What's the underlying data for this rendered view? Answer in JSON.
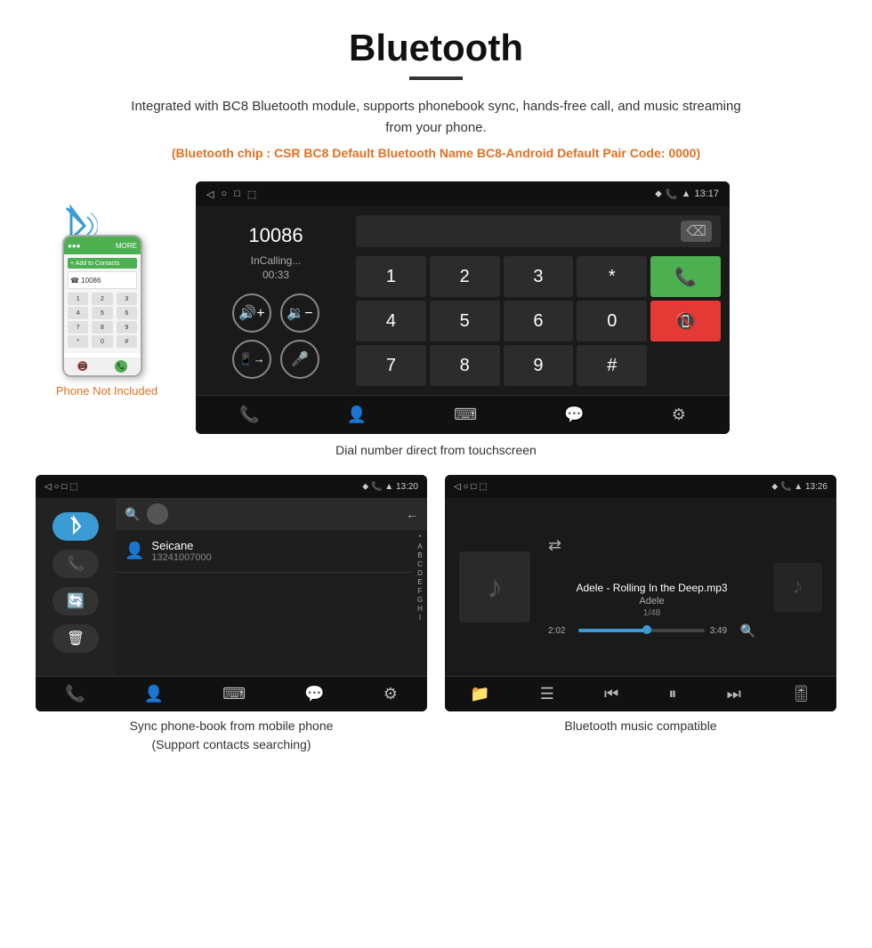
{
  "header": {
    "title": "Bluetooth",
    "intro": "Integrated with BC8 Bluetooth module, supports phonebook sync, hands-free call, and music streaming from your phone.",
    "spec": "(Bluetooth chip : CSR BC8    Default Bluetooth Name BC8-Android    Default Pair Code: 0000)"
  },
  "phone_aside": {
    "not_included": "Phone Not Included"
  },
  "dial_screen": {
    "status_bar": {
      "icons_left": [
        "◁",
        "○",
        "□"
      ],
      "icons_right": [
        "♦",
        "📞",
        "▲",
        "13:17"
      ]
    },
    "number": "10086",
    "status": "InCalling...",
    "timer": "00:33",
    "numpad": [
      "1",
      "2",
      "3",
      "*",
      "4",
      "5",
      "6",
      "0",
      "7",
      "8",
      "9",
      "#"
    ]
  },
  "caption_dial": "Dial number direct from touchscreen",
  "phonebook_screen": {
    "status_bar": {
      "time": "13:20"
    },
    "contact": {
      "name": "Seicane",
      "number": "13241007000"
    },
    "alpha_letters": [
      "*",
      "A",
      "B",
      "C",
      "D",
      "E",
      "F",
      "G",
      "H",
      "I"
    ]
  },
  "caption_phonebook_line1": "Sync phone-book from mobile phone",
  "caption_phonebook_line2": "(Support contacts searching)",
  "music_screen": {
    "status_bar": {
      "time": "13:26"
    },
    "title": "Adele - Rolling In the Deep.mp3",
    "artist": "Adele",
    "track_info": "1/48",
    "time_current": "2:02",
    "time_total": "3:49",
    "progress_percent": 55
  },
  "caption_music": "Bluetooth music compatible"
}
